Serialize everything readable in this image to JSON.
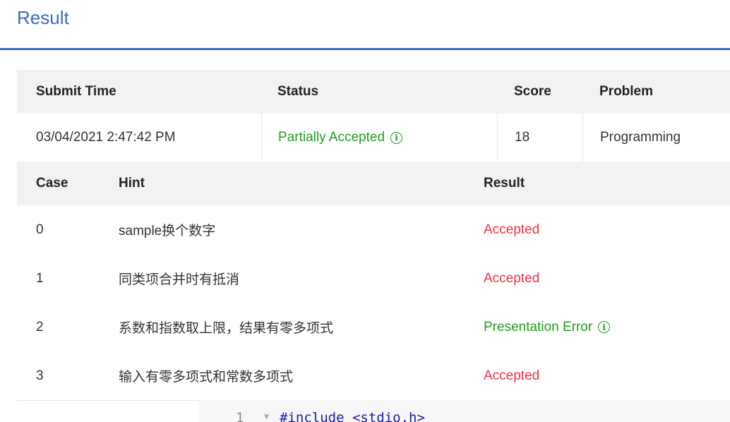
{
  "page": {
    "title": "Result"
  },
  "submission": {
    "headers": {
      "submit_time": "Submit Time",
      "status": "Status",
      "score": "Score",
      "problem": "Problem"
    },
    "submit_time": "03/04/2021 2:47:42 PM",
    "status": "Partially Accepted",
    "score": "18",
    "problem": "Programming"
  },
  "cases": {
    "headers": {
      "case": "Case",
      "hint": "Hint",
      "result": "Result"
    },
    "rows": [
      {
        "case": "0",
        "hint": "sample换个数字",
        "result": "Accepted",
        "result_color": "#ee3344"
      },
      {
        "case": "1",
        "hint": "同类项合并时有抵消",
        "result": "Accepted",
        "result_color": "#ee3344"
      },
      {
        "case": "2",
        "hint": "系数和指数取上限，结果有零多项式",
        "result": "Presentation Error",
        "result_color": "#1f9e1f"
      },
      {
        "case": "3",
        "hint": "输入有零多项式和常数多项式",
        "result": "Accepted",
        "result_color": "#ee3344"
      }
    ]
  },
  "code": {
    "line_number": "1",
    "first_line": "#include <stdio.h>"
  },
  "icons": {
    "info": "info-circle-icon",
    "fold": "fold-arrow-icon"
  },
  "colors": {
    "accent": "#3b6bc5",
    "accepted": "#ee3344",
    "partial": "#1f9e1f"
  }
}
